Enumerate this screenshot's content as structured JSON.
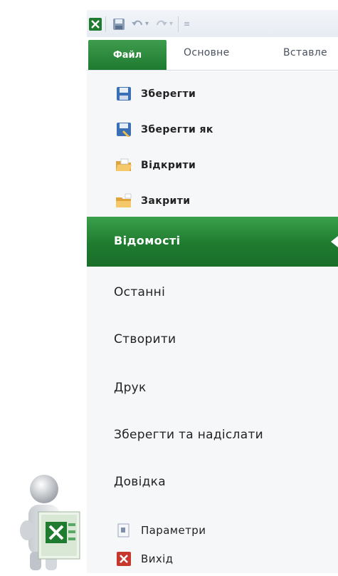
{
  "ribbon": {
    "tab_file": "Файл",
    "tab_home": "Основне",
    "tab_insert": "Вставле"
  },
  "commands": {
    "save": "Зберегти",
    "save_as": "Зберегти як",
    "open": "Відкрити",
    "close": "Закрити"
  },
  "menu": {
    "info": "Відомості",
    "recent": "Останні",
    "new": "Створити",
    "print": "Друк",
    "save_send": "Зберегти та надіслати",
    "help": "Довідка",
    "options": "Параметри",
    "exit": "Вихід"
  },
  "icons": {
    "app": "excel-icon",
    "save": "floppy-disk-icon",
    "undo": "undo-icon",
    "redo": "redo-icon"
  },
  "colors": {
    "accent": "#1f7b2f",
    "accent_light": "#3aa04a"
  }
}
